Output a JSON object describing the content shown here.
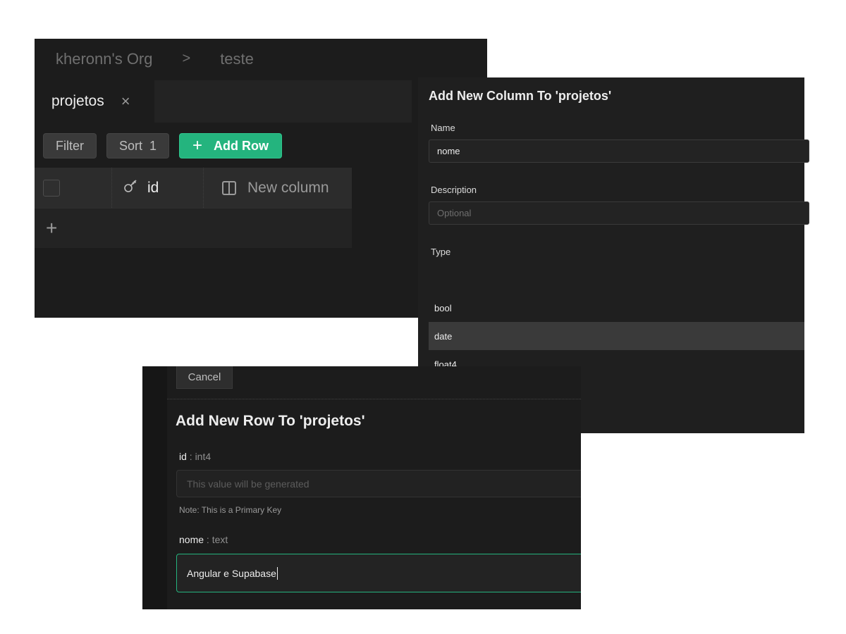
{
  "table_view": {
    "breadcrumb": {
      "org": "kheronn's Org",
      "separator": ">",
      "project": "teste"
    },
    "tab": {
      "label": "projetos",
      "close": "×"
    },
    "toolbar": {
      "filter_label": "Filter",
      "sort_label": "Sort",
      "sort_count": "1",
      "add_row_icon": "+",
      "add_row_label": "Add Row"
    },
    "grid": {
      "id_icon": "key-icon",
      "id_label": "id",
      "new_column_label": "New column",
      "add_row_icon": "+"
    }
  },
  "add_column_panel": {
    "title": "Add New Column To 'projetos'",
    "name_label": "Name",
    "name_value": "nome",
    "description_label": "Description",
    "description_placeholder": "Optional",
    "type_label": "Type",
    "type_options": [
      "bool",
      "date",
      "float4"
    ],
    "selected_option": "date"
  },
  "add_row_panel": {
    "cancel_label": "Cancel",
    "title": "Add New Row To 'projetos'",
    "id_field": {
      "name": "id",
      "type": ": int4",
      "placeholder": "This value will be generated",
      "note": "Note: This is a Primary Key"
    },
    "nome_field": {
      "name": "nome",
      "type": ": text",
      "value": "Angular e Supabase"
    }
  },
  "colors": {
    "accent": "#24b47e",
    "panel_bg": "#1c1c1c",
    "selected_option": "#3a3a3a"
  }
}
